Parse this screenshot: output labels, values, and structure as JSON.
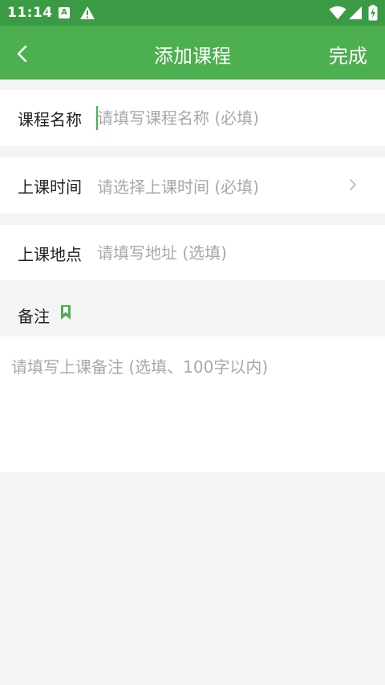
{
  "status_bar": {
    "time": "11:14",
    "a_badge": "A",
    "icons": [
      "warning-icon",
      "wifi-icon",
      "signal-icon",
      "battery-charging-icon"
    ]
  },
  "app_bar": {
    "title": "添加课程",
    "done_label": "完成",
    "back_icon": "chevron-left-icon",
    "color": "#4caf50"
  },
  "form": {
    "course_name": {
      "label": "课程名称",
      "placeholder": "请填写课程名称 (必填)",
      "value": ""
    },
    "class_time": {
      "label": "上课时间",
      "placeholder": "请选择上课时间 (必填)"
    },
    "class_location": {
      "label": "上课地点",
      "placeholder": "请填写地址 (选填)",
      "value": ""
    },
    "remarks": {
      "label": "备注",
      "placeholder": "请填写上课备注 (选填、100字以内)",
      "value": ""
    }
  },
  "colors": {
    "accent": "#4caf50",
    "statusbar": "#3b9b44",
    "background": "#f4f4f4"
  }
}
